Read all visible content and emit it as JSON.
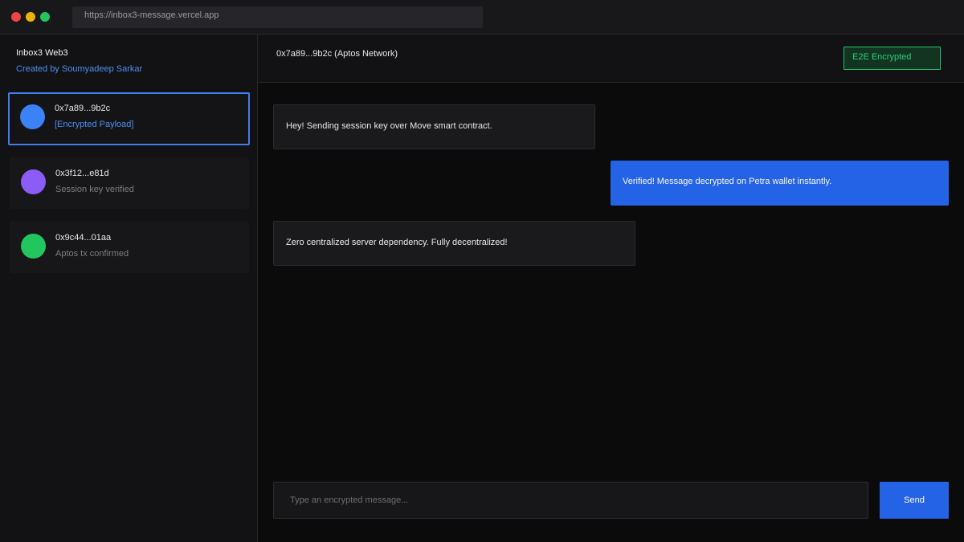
{
  "browser": {
    "url": "https://inbox3-message.vercel.app",
    "controls": {
      "close_color": "#ef4444",
      "minimize_color": "#eab308",
      "maximize_color": "#22c55e"
    }
  },
  "sidebar": {
    "title": "Inbox3 Web3",
    "subtitle": "Created by Soumyadeep Sarkar",
    "contacts": [
      {
        "address": "0x7a89...9b2c",
        "preview": "[Encrypted Payload]",
        "avatar_color": "#3b82f6",
        "active": true
      },
      {
        "address": "0x3f12...e81d",
        "preview": "Session key verified",
        "avatar_color": "#8b5cf6",
        "active": false
      },
      {
        "address": "0x9c44...01aa",
        "preview": "Aptos tx confirmed",
        "avatar_color": "#22c55e",
        "active": false
      }
    ]
  },
  "chat": {
    "title": "0x7a89...9b2c (Aptos Network)",
    "badge": "E2E Encrypted",
    "messages": [
      {
        "direction": "incoming",
        "text": "Hey! Sending session key over Move smart contract."
      },
      {
        "direction": "outgoing",
        "text": "Verified! Message decrypted on Petra wallet instantly."
      },
      {
        "direction": "incoming",
        "text": "Zero centralized server dependency. Fully decentralized!"
      }
    ]
  },
  "composer": {
    "placeholder": "Type an encrypted message...",
    "value": "",
    "send_label": "Send"
  },
  "colors": {
    "accent": "#2563e6",
    "encrypted_badge": "#2fd07a",
    "link": "#4d8ef0"
  }
}
